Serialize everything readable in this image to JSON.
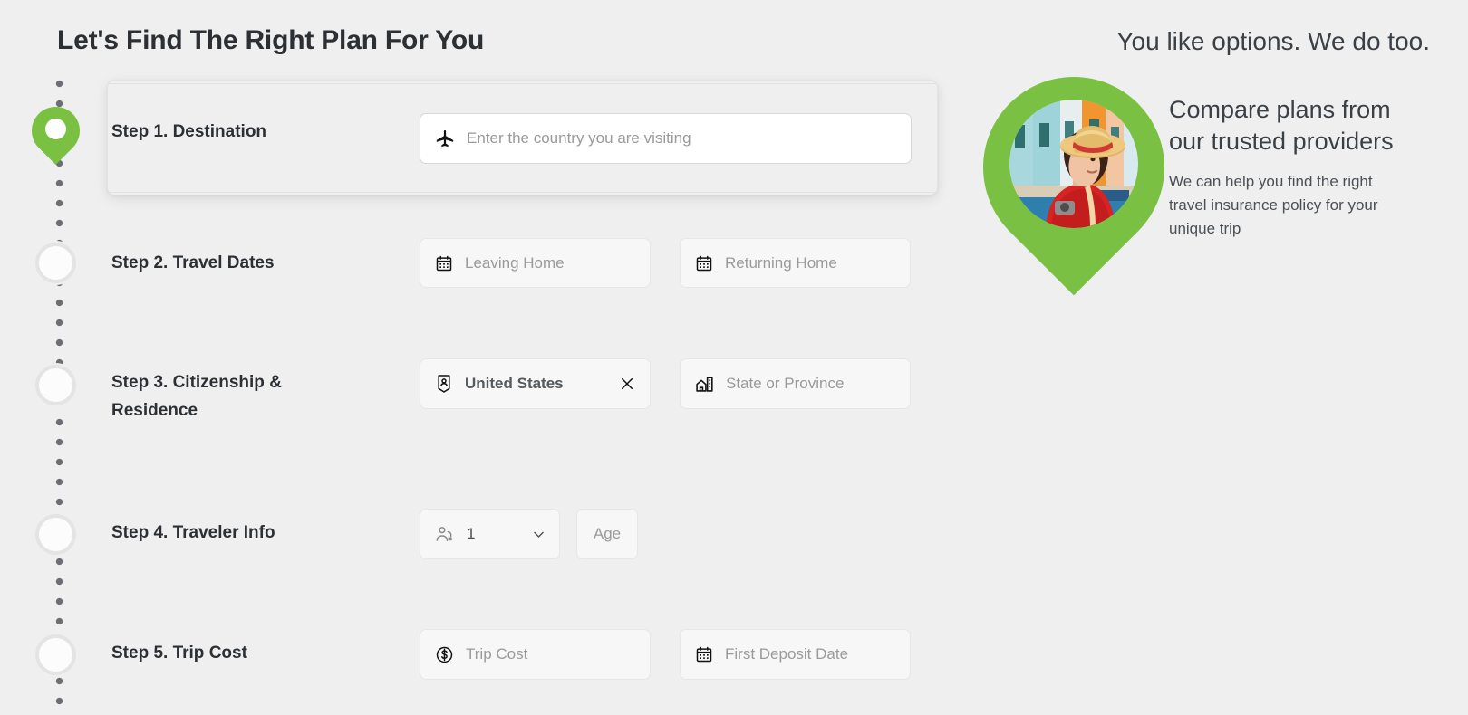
{
  "page": {
    "title": "Let's Find The Right Plan For You",
    "background_color": "#efefef",
    "accent_color": "#7ac143",
    "heading_color": "#2c3034"
  },
  "steps": [
    {
      "id": "destination",
      "label": "Step 1. Destination",
      "active": true,
      "marker": "green-map-pin",
      "fields": [
        {
          "name": "destination-country",
          "icon": "airplane-icon",
          "placeholder": "Enter the country you are visiting",
          "value": "",
          "style": "white"
        }
      ]
    },
    {
      "id": "travel-dates",
      "label": "Step 2. Travel Dates",
      "active": false,
      "marker": "empty-circle",
      "fields": [
        {
          "name": "leaving-home-date",
          "icon": "calendar-icon",
          "placeholder": "Leaving Home",
          "value": "",
          "style": "grey"
        },
        {
          "name": "returning-home-date",
          "icon": "calendar-icon",
          "placeholder": "Returning Home",
          "value": "",
          "style": "grey"
        }
      ]
    },
    {
      "id": "citizenship-residence",
      "label": "Step 3. Citizenship & Residence",
      "active": false,
      "marker": "empty-circle",
      "fields": [
        {
          "name": "citizenship-country",
          "icon": "passport-badge-icon",
          "placeholder": "",
          "value": "United States",
          "clear_label": "×",
          "style": "grey"
        },
        {
          "name": "state-or-province",
          "icon": "building-icon",
          "placeholder": "State or Province",
          "value": "",
          "style": "grey"
        }
      ]
    },
    {
      "id": "traveler-info",
      "label": "Step 4. Traveler Info",
      "active": false,
      "marker": "empty-circle",
      "fields": [
        {
          "name": "traveler-count-select",
          "icon": "travelers-icon",
          "placeholder": "",
          "value": "1",
          "caret": "chevron-down-icon",
          "style": "grey"
        },
        {
          "name": "traveler-age",
          "icon": "",
          "placeholder": "Age",
          "value": "",
          "style": "grey"
        }
      ]
    },
    {
      "id": "trip-cost",
      "label": "Step 5. Trip Cost",
      "active": false,
      "marker": "empty-circle",
      "fields": [
        {
          "name": "trip-cost-amount",
          "icon": "dollar-circle-icon",
          "placeholder": "Trip Cost",
          "value": "",
          "style": "grey"
        },
        {
          "name": "first-deposit-date",
          "icon": "calendar-icon",
          "placeholder": "First Deposit Date",
          "value": "",
          "style": "grey"
        }
      ]
    }
  ],
  "sidebar": {
    "tagline": "You like options. We do too.",
    "promo_title": "Compare plans from our trusted providers",
    "promo_subtitle": "We can help you find the right travel insurance policy for your unique trip",
    "photo_alt": "traveler-in-red-with-straw-hat"
  }
}
